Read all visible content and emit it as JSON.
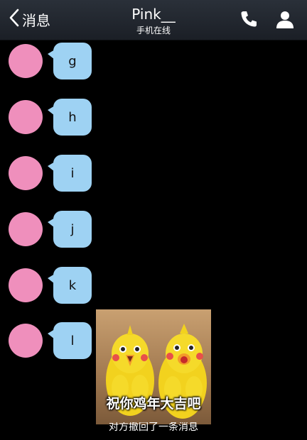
{
  "header": {
    "back_label": "消息",
    "title": "Pink__",
    "subtitle": "手机在线"
  },
  "messages": [
    {
      "text": "g"
    },
    {
      "text": "h"
    },
    {
      "text": "i"
    },
    {
      "text": "j"
    },
    {
      "text": "k"
    },
    {
      "text": "l"
    }
  ],
  "sticker": {
    "caption": "祝你鸡年大吉吧"
  },
  "notice": "对方撤回了一条消息",
  "colors": {
    "avatar": "#ef8fbc",
    "bubble": "#9ed2f3",
    "background": "#000000"
  }
}
